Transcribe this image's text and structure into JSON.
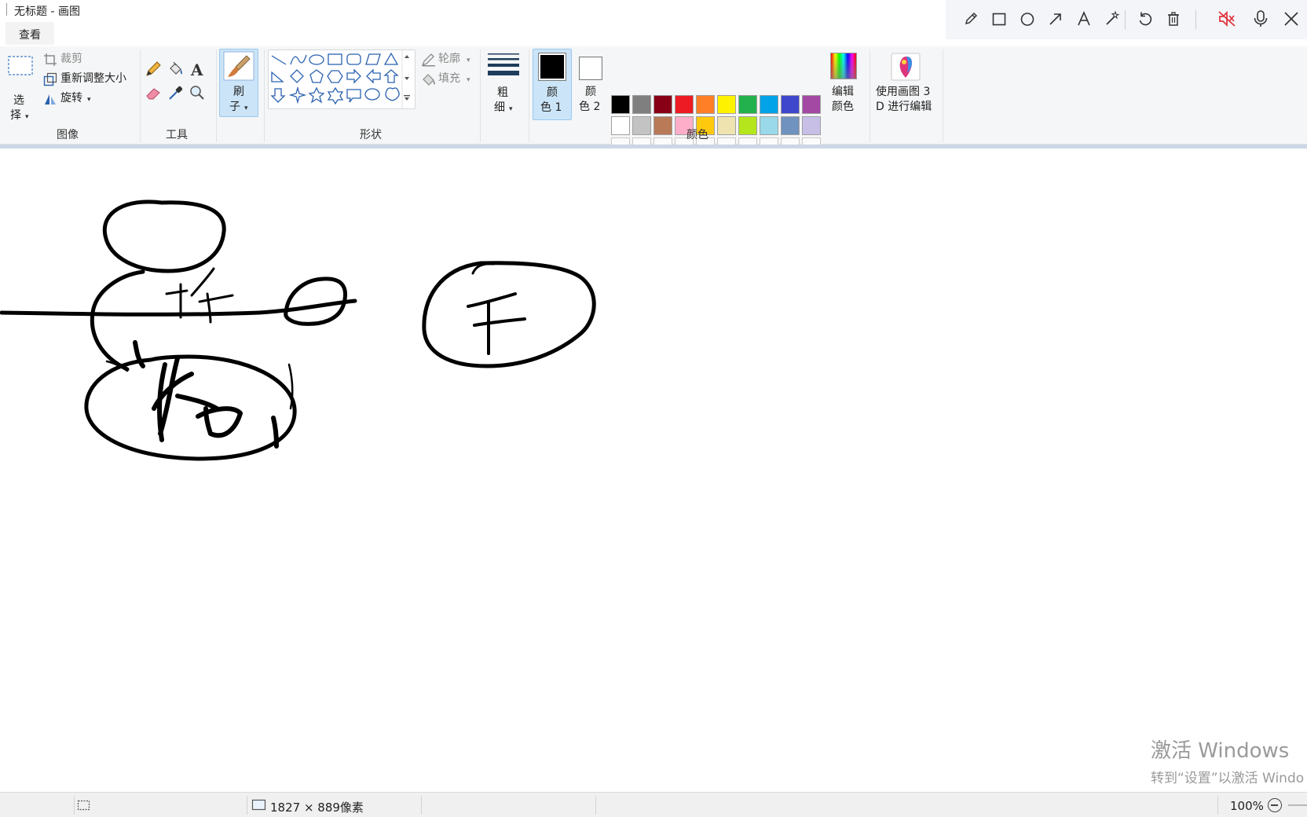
{
  "window": {
    "title": "无标题 - 画图"
  },
  "tabs": [
    {
      "label": "查看"
    }
  ],
  "pen_toolbar": {
    "tools": [
      "pencil-icon",
      "rectangle-icon",
      "circle-icon",
      "arrow-icon",
      "text-icon",
      "magic-wand-icon",
      "undo-icon",
      "trash-icon",
      "mute-icon",
      "microphone-icon",
      "close-icon"
    ],
    "mute_color": "#e0313b"
  },
  "ribbon": {
    "image_group": {
      "label": "图像",
      "select_top": "选",
      "select_bottom": "择",
      "crop": "裁剪",
      "resize": "重新调整大小",
      "rotate": "旋转"
    },
    "tools_group": {
      "label": "工具"
    },
    "brush": {
      "top": "刷",
      "bottom": "子"
    },
    "shapes_group": {
      "label": "形状",
      "outline": "轮廓",
      "fill": "填充"
    },
    "size": {
      "top": "粗",
      "bottom": "细"
    },
    "colors_group": {
      "label": "颜色",
      "color1_top": "颜",
      "color1_bottom": "色 1",
      "color2_top": "颜",
      "color2_bottom": "色 2",
      "edit_top": "编辑",
      "edit_bottom": "颜色",
      "color1_value": "#000000",
      "color2_value": "#ffffff",
      "row1": [
        "#000000",
        "#7f7f7f",
        "#880015",
        "#ed1c24",
        "#ff7f27",
        "#fff200",
        "#22b14c",
        "#00a2e8",
        "#3f48cc",
        "#a349a4"
      ],
      "row2": [
        "#ffffff",
        "#c3c3c3",
        "#b97a57",
        "#ffaec9",
        "#ffc90e",
        "#efe4b0",
        "#b5e61d",
        "#99d9ea",
        "#7092be",
        "#c8bfe7"
      ]
    },
    "paint3d": {
      "top": "使用画图 3",
      "bottom": "D 进行编辑"
    },
    "accent": "#cce4f7"
  },
  "canvas": {
    "ink_color": "#000000"
  },
  "watermark": {
    "line1": "激活 Windows",
    "line2": "转到“设置”以激活 Windo"
  },
  "status": {
    "dimensions": "1827 × 889像素",
    "zoom": "100%"
  }
}
